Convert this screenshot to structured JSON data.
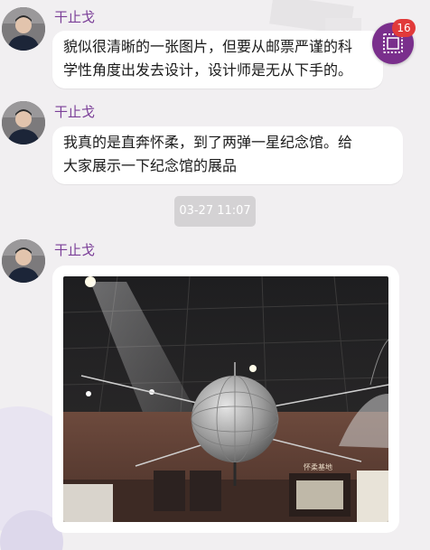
{
  "messages": [
    {
      "sender": "干止戈",
      "lines": [
        "貌似很清晰的一张图片，但要从邮票严谨的科",
        "学性角度出发去设计，设计师是无从下手的。"
      ]
    },
    {
      "sender": "干止戈",
      "lines": [
        "我真的是直奔怀柔，到了两弹一星纪念馆。给",
        "大家展示一下纪念馆的展品"
      ]
    },
    {
      "sender": "干止戈"
    }
  ],
  "timestamp": "03-27 11:07",
  "floating_badge": {
    "count": "16",
    "icon": "stamp-icon"
  },
  "photo": {
    "sign_text": "怀柔基地"
  },
  "colors": {
    "sender_name": "#7b3f98",
    "badge_bg": "#7a2f8c",
    "badge_count_bg": "#e13a3a",
    "background": "#f1eff1"
  }
}
